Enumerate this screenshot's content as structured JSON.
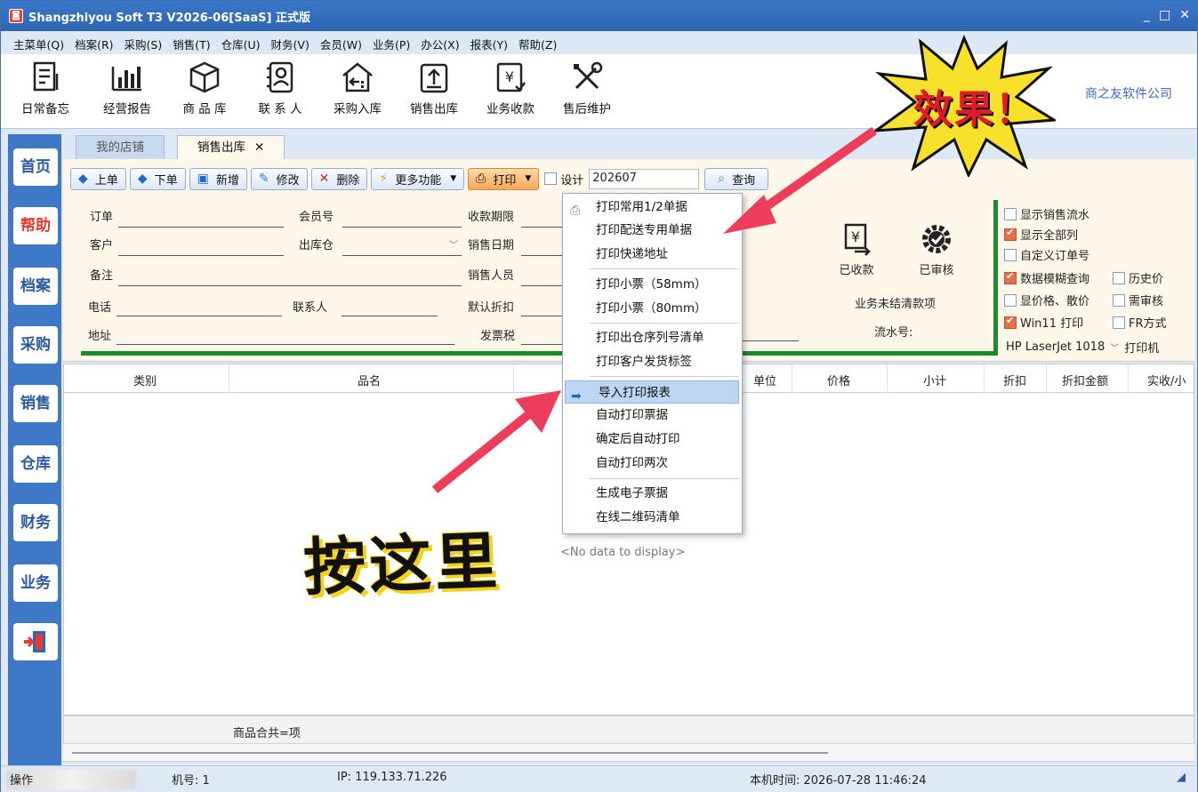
{
  "window": {
    "title": "Shangzhiyou Soft T3 V2026-06[SaaS] 正式版",
    "app_icon": "app-logo-icon",
    "controls": [
      "_",
      "□",
      "✕"
    ]
  },
  "menu": [
    "主菜单(Q)",
    "档案(R)",
    "采购(S)",
    "销售(T)",
    "仓库(U)",
    "财务(V)",
    "会员(W)",
    "业务(P)",
    "办公(X)",
    "报表(Y)",
    "帮助(Z)"
  ],
  "ribbon": {
    "buttons": [
      {
        "label": "日常备忘",
        "icon": "memo-icon"
      },
      {
        "label": "经营报告",
        "icon": "bar-chart-icon"
      },
      {
        "label": "商 品 库",
        "icon": "box-icon"
      },
      {
        "label": "联 系 人",
        "icon": "contacts-icon"
      },
      {
        "label": "采购入库",
        "icon": "warehouse-in-icon"
      },
      {
        "label": "销售出库",
        "icon": "upload-icon"
      },
      {
        "label": "业务收款",
        "icon": "yen-receipt-icon"
      },
      {
        "label": "售后维护",
        "icon": "tools-icon"
      }
    ],
    "company": "商之友软件公司"
  },
  "leftnav": [
    "首页",
    "帮助",
    "档案",
    "采购",
    "销售",
    "仓库",
    "财务",
    "业务"
  ],
  "tabs": {
    "shop": "我的店铺",
    "sales": "销售出库",
    "close": "✕"
  },
  "toolbar": {
    "prev": "上单",
    "next": "下单",
    "add": "新增",
    "edit": "修改",
    "delete": "删除",
    "more": "更多功能",
    "print": "打印",
    "design": "设计",
    "date": "202607",
    "query": "查询"
  },
  "form": {
    "order": "订单",
    "member_no": "会员号",
    "due": "收款期限",
    "customer": "客户",
    "out_warehouse": "出库仓",
    "sale_date": "销售日期",
    "remark": "备注",
    "salesperson": "销售人员",
    "phone": "电话",
    "contact": "联系人",
    "discount": "默认折扣",
    "address": "地址",
    "invoice_tax": "发票税",
    "received": "已收款",
    "reviewed": "已审核",
    "unsettled": "业务未结清款项",
    "serial": "流水号:"
  },
  "options": {
    "show_flow": "显示销售流水",
    "show_all": "显示全部列",
    "custom_order": "自定义订单号",
    "fuzzy": "数据模糊查询",
    "history": "历史价",
    "show_price": "显价格、散价",
    "need_review": "需审核",
    "win11": "Win11 打印",
    "fr": "FR方式",
    "printer": "HP LaserJet 1018",
    "printer_label": "打印机",
    "checked": [
      "show_all",
      "fuzzy",
      "win11"
    ]
  },
  "dropdown": [
    "打印常用1/2单据",
    "打印配送专用单据",
    "打印快递地址",
    "打印小票（58mm）",
    "打印小票（80mm）",
    "打印出仓序列号清单",
    "打印客户发货标签",
    "导入打印报表",
    "自动打印票据",
    "确定后自动打印",
    "自动打印两次",
    "生成电子票据",
    "在线二维码清单"
  ],
  "grid": {
    "columns": [
      "类别",
      "品名",
      "单位",
      "价格",
      "小计",
      "折扣",
      "折扣金额",
      "实收/小"
    ],
    "empty": "<No data to display>",
    "footer": "商品合共=项"
  },
  "status": {
    "machine": "机号: 1",
    "ip": "IP: 119.133.71.226",
    "time": "本机时间: 2026-07-28 11:46:24",
    "op": "操作"
  },
  "overlay": {
    "effect": "效果！",
    "press_here": "按这里"
  },
  "colors": {
    "title": "#2e65b0",
    "accent_red": "#e3192b",
    "green": "#1b8b2b",
    "highlight": "#bcd6f3"
  }
}
